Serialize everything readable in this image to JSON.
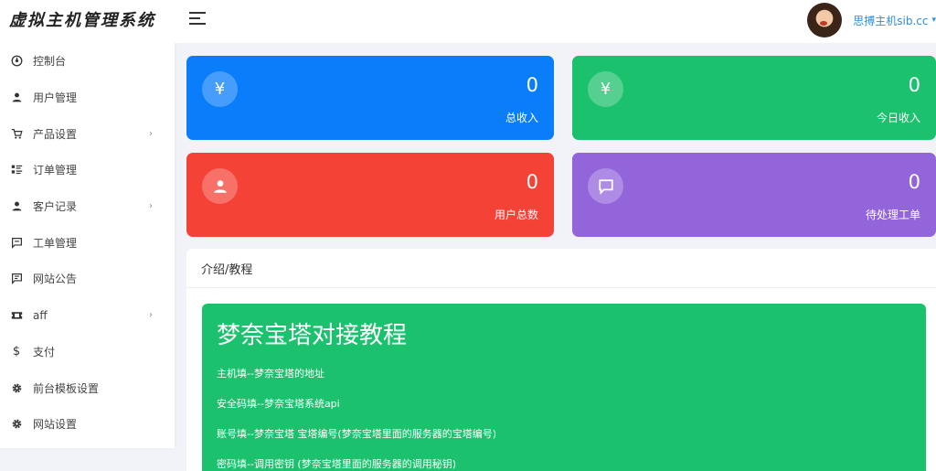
{
  "brand": "虚拟主机管理系统",
  "sidebar": {
    "items": [
      {
        "label": "控制台",
        "icon": "dashboard-icon",
        "has_submenu": false
      },
      {
        "label": "用户管理",
        "icon": "user-icon",
        "has_submenu": false
      },
      {
        "label": "产品设置",
        "icon": "cart-icon",
        "has_submenu": true
      },
      {
        "label": "订单管理",
        "icon": "list-icon",
        "has_submenu": false
      },
      {
        "label": "客户记录",
        "icon": "user-icon",
        "has_submenu": true
      },
      {
        "label": "工单管理",
        "icon": "message-icon",
        "has_submenu": false
      },
      {
        "label": "网站公告",
        "icon": "announcement-icon",
        "has_submenu": false
      },
      {
        "label": "aff",
        "icon": "ticket-icon",
        "has_submenu": true
      },
      {
        "label": "支付",
        "icon": "dollar-icon",
        "has_submenu": false
      },
      {
        "label": "前台模板设置",
        "icon": "gear-icon",
        "has_submenu": false
      },
      {
        "label": "网站设置",
        "icon": "gear-icon",
        "has_submenu": false
      }
    ]
  },
  "header": {
    "username": "思搏主机sib.cc"
  },
  "stats": {
    "total_income": {
      "value": "0",
      "label": "总收入",
      "icon": "yen-icon",
      "color": "#0a7dfb"
    },
    "today_income": {
      "value": "0",
      "label": "今日收入",
      "icon": "yen-icon",
      "color": "#1cc16d"
    },
    "total_users": {
      "value": "0",
      "label": "用户总数",
      "icon": "user-icon",
      "color": "#f54236"
    },
    "pending_tickets": {
      "value": "0",
      "label": "待处理工单",
      "icon": "chat-icon",
      "color": "#9365db"
    }
  },
  "intro": {
    "header": "介绍/教程",
    "title": "梦奈宝塔对接教程",
    "lines": [
      "主机填--梦奈宝塔的地址",
      "安全码填--梦奈宝塔系统api",
      "账号填--梦奈宝塔 宝塔编号(梦奈宝塔里面的服务器的宝塔编号)",
      "密码填--调用密钥 (梦奈宝塔里面的服务器的调用秘钥)"
    ]
  }
}
